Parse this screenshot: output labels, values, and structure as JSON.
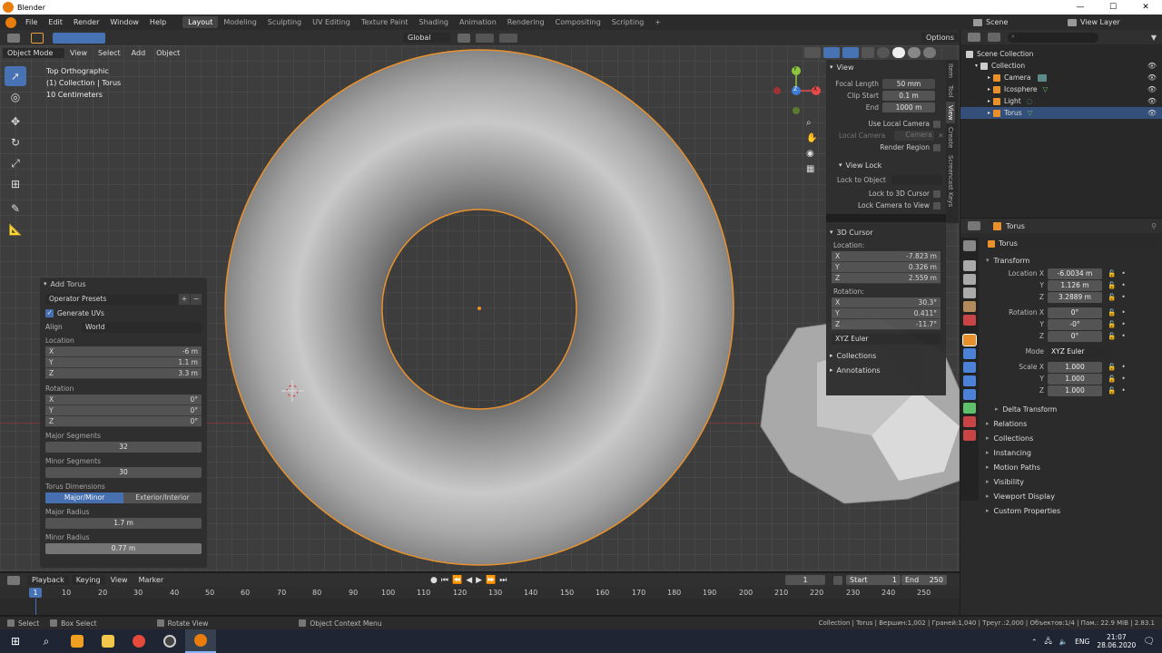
{
  "window": {
    "title": "Blender",
    "min": "—",
    "max": "☐",
    "close": "✕"
  },
  "menu": {
    "items": [
      "File",
      "Edit",
      "Render",
      "Window",
      "Help"
    ],
    "tabs": [
      "Layout",
      "Modeling",
      "Sculpting",
      "UV Editing",
      "Texture Paint",
      "Shading",
      "Animation",
      "Rendering",
      "Compositing",
      "Scripting"
    ],
    "add_tab": "+",
    "scene": "Scene",
    "view_layer": "View Layer"
  },
  "tool_header": {
    "orientation": "Global",
    "options": "Options"
  },
  "viewport_header": {
    "mode": "Object Mode",
    "menus": [
      "View",
      "Select",
      "Add",
      "Object"
    ]
  },
  "overlay": {
    "line1": "Top Orthographic",
    "line2": "(1) Collection | Torus",
    "line3": "10 Centimeters"
  },
  "gizmo": {
    "x": "X",
    "y": "Y",
    "z": "Z"
  },
  "npanel": {
    "view_title": "View",
    "focal_length_label": "Focal Length",
    "focal_length": "50 mm",
    "clip_start_label": "Clip Start",
    "clip_start": "0.1 m",
    "end_label": "End",
    "clip_end": "1000 m",
    "use_local_camera": "Use Local Camera",
    "local_camera": "Local Camera",
    "camera": "Camera",
    "render_region": "Render Region",
    "view_lock_title": "View Lock",
    "lock_to_object": "Lock to Object",
    "lock_to_cursor": "Lock to 3D Cursor",
    "lock_camera": "Lock Camera to View",
    "cursor_title": "3D Cursor",
    "location_label": "Location:",
    "cursor_location": [
      {
        "axis": "X",
        "value": "-7.823 m"
      },
      {
        "axis": "Y",
        "value": "0.326 m"
      },
      {
        "axis": "Z",
        "value": "2.559 m"
      }
    ],
    "rotation_label": "Rotation:",
    "cursor_rotation": [
      {
        "axis": "X",
        "value": "30.3°"
      },
      {
        "axis": "Y",
        "value": "0.411°"
      },
      {
        "axis": "Z",
        "value": "-11.7°"
      }
    ],
    "rotation_mode": "XYZ Euler",
    "collections": "Collections",
    "annotations": "Annotations"
  },
  "vtabs": [
    "Item",
    "Tool",
    "View",
    "Create",
    "Screencast Keys"
  ],
  "add_torus": {
    "title": "Add Torus",
    "presets": "Operator Presets",
    "generate_uvs": "Generate UVs",
    "align_label": "Align",
    "align": "World",
    "location_label": "Location",
    "location": [
      {
        "axis": "X",
        "value": "-6 m"
      },
      {
        "axis": "Y",
        "value": "1.1 m"
      },
      {
        "axis": "Z",
        "value": "3.3 m"
      }
    ],
    "rotation_label": "Rotation",
    "rotation": [
      {
        "axis": "X",
        "value": "0°"
      },
      {
        "axis": "Y",
        "value": "0°"
      },
      {
        "axis": "Z",
        "value": "0°"
      }
    ],
    "major_segments_label": "Major Segments",
    "major_segments": "32",
    "minor_segments_label": "Minor Segments",
    "minor_segments": "30",
    "dimensions_label": "Torus Dimensions",
    "dim_major_minor": "Major/Minor",
    "dim_ext_int": "Exterior/Interior",
    "major_radius_label": "Major Radius",
    "major_radius": "1.7 m",
    "minor_radius_label": "Minor Radius",
    "minor_radius": "0.77 m"
  },
  "outliner": {
    "root": "Scene Collection",
    "collection": "Collection",
    "items": [
      "Camera",
      "Icosphere",
      "Light",
      "Torus"
    ]
  },
  "properties": {
    "object_name": "Torus",
    "data_name": "Torus",
    "transform": "Transform",
    "location_label": "Location X",
    "location": [
      "-6.0034 m",
      "1.126 m",
      "3.2889 m"
    ],
    "rotation_label": "Rotation X",
    "rotation": [
      "0°",
      "-0°",
      "0°"
    ],
    "mode_label": "Mode",
    "mode": "XYZ Euler",
    "scale_label": "Scale X",
    "scale": [
      "1.000",
      "1.000",
      "1.000"
    ],
    "axis_y": "Y",
    "axis_z": "Z",
    "sections": [
      "Delta Transform",
      "Relations",
      "Collections",
      "Instancing",
      "Motion Paths",
      "Visibility",
      "Viewport Display",
      "Custom Properties"
    ]
  },
  "timeline": {
    "menus": [
      "Playback",
      "Keying",
      "View",
      "Marker"
    ],
    "current": "1",
    "start_label": "Start",
    "start": "1",
    "end_label": "End",
    "end": "250",
    "ticks": [
      "10",
      "20",
      "30",
      "40",
      "50",
      "60",
      "70",
      "80",
      "90",
      "100",
      "110",
      "120",
      "130",
      "140",
      "150",
      "160",
      "170",
      "180",
      "190",
      "200",
      "210",
      "220",
      "230",
      "240",
      "250"
    ],
    "frame": "1"
  },
  "statusbar": {
    "select": "Select",
    "box_select": "Box Select",
    "rotate_view": "Rotate View",
    "context_menu": "Object Context Menu",
    "stats": "Collection | Torus | Вершин:1,002 | Граней:1,040 | Треуг.:2,000 | Объектов:1/4 | Пам.: 22.9 MiB | 2.83.1"
  },
  "taskbar": {
    "lang": "ENG",
    "time": "21:07",
    "date": "28.06.2020"
  }
}
